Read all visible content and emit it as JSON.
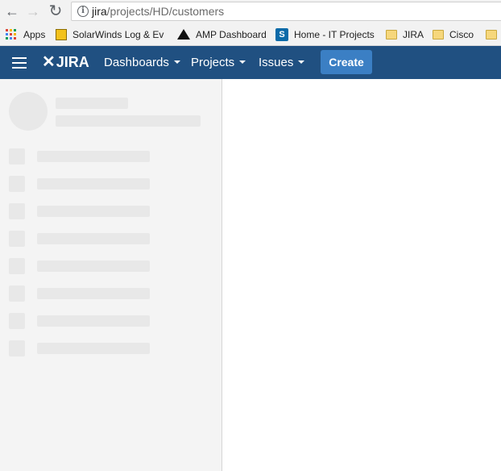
{
  "browser": {
    "back_glyph": "←",
    "forward_glyph": "→",
    "reload_glyph": "↻",
    "info_glyph": "i",
    "url_host": "jira",
    "url_path": "/projects/HD/customers"
  },
  "bookmarks": [
    {
      "label": "Apps",
      "icon": "apps-grid-icon"
    },
    {
      "label": "SolarWinds Log & Ev",
      "icon": "solarwinds-icon"
    },
    {
      "label": "AMP Dashboard",
      "icon": "amp-icon"
    },
    {
      "label": "Home - IT Projects",
      "icon": "sharepoint-icon"
    },
    {
      "label": "JIRA",
      "icon": "folder-icon"
    },
    {
      "label": "Cisco",
      "icon": "folder-icon"
    }
  ],
  "jira_nav": {
    "logo_mark": "✕",
    "logo_text": "JIRA",
    "dashboards": "Dashboards",
    "projects": "Projects",
    "issues": "Issues",
    "create": "Create"
  },
  "colors": {
    "header": "#205081",
    "create_button": "#3b7fc4",
    "sidebar": "#f4f4f4",
    "skeleton": "#e8e8e8"
  }
}
